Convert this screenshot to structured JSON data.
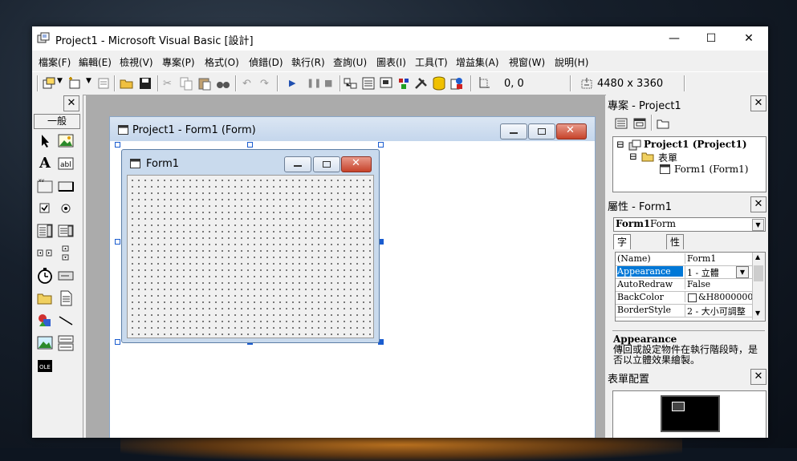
{
  "window": {
    "title": "Project1 - Microsoft Visual Basic [設計]",
    "controls": {
      "minimize": "—",
      "maximize": "☐",
      "close": "✕"
    }
  },
  "menu": [
    "檔案(F)",
    "編輯(E)",
    "檢視(V)",
    "專案(P)",
    "格式(O)",
    "偵錯(D)",
    "執行(R)",
    "查詢(U)",
    "圖表(I)",
    "工具(T)",
    "增益集(A)",
    "視窗(W)",
    "說明(H)"
  ],
  "toolbar": {
    "position": "0, 0",
    "size": "4480 x 3360"
  },
  "toolbox": {
    "tab_label": "一般",
    "close": "✕"
  },
  "designer": {
    "mdi_title": "Project1 - Form1 (Form)",
    "form_title": "Form1"
  },
  "project_panel": {
    "title": "專案 - Project1",
    "close": "✕",
    "tree": {
      "project": "Project1 (Project1)",
      "folder": "表單",
      "form": "Form1 (Form1)"
    }
  },
  "properties_panel": {
    "title": "屬性 - Form1",
    "close": "✕",
    "object_name": "Form1",
    "object_type": "Form",
    "tabs": [
      "字母順序",
      "性質分類"
    ],
    "rows": [
      {
        "name": "(Name)",
        "value": "Form1"
      },
      {
        "name": "Appearance",
        "value": "1 - 立體"
      },
      {
        "name": "AutoRedraw",
        "value": "False"
      },
      {
        "name": "BackColor",
        "value": "&H8000000"
      },
      {
        "name": "BorderStyle",
        "value": "2 - 大小可調整"
      }
    ],
    "description_title": "Appearance",
    "description_text": "傳回或設定物件在執行階段時，是否以立體效果繪製。"
  },
  "layout_panel": {
    "title": "表單配置",
    "close": "✕"
  },
  "colors": {
    "accent": "#1a5ccf",
    "selection": "#0078d7"
  }
}
